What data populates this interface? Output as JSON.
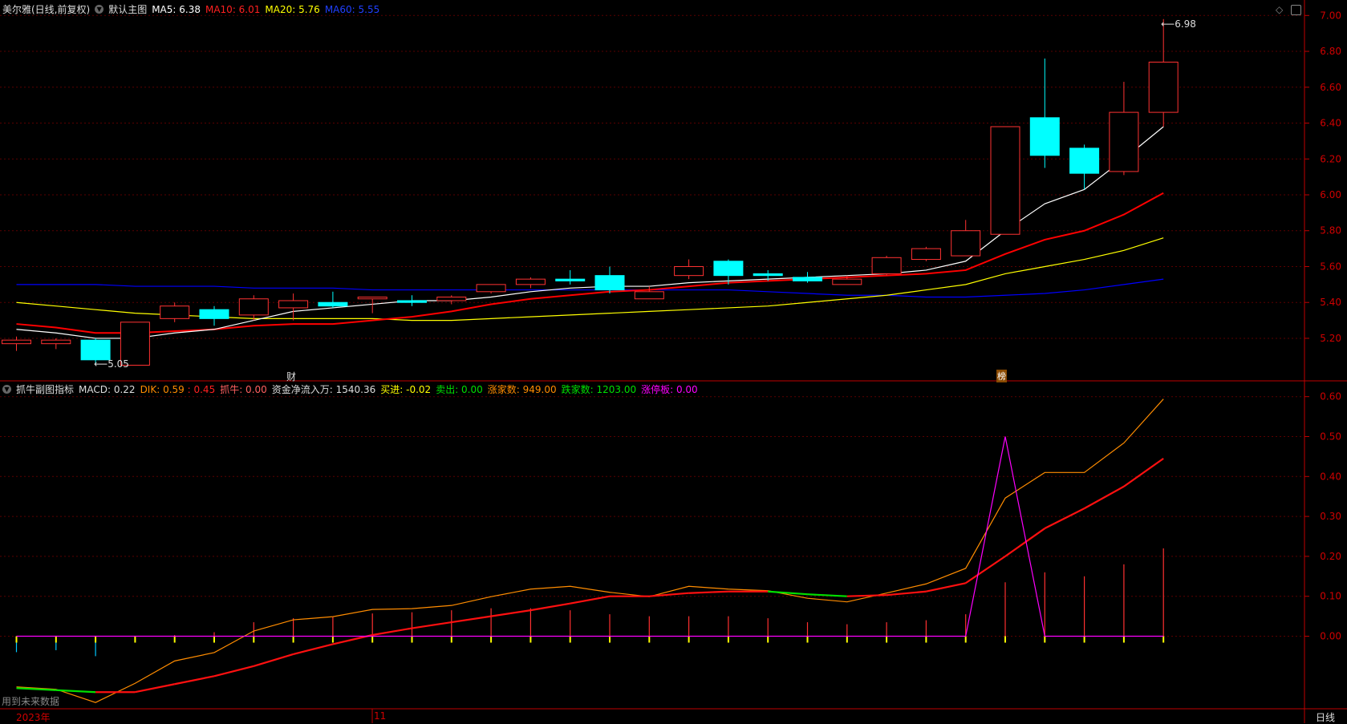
{
  "main_header": {
    "title": "美尔雅(日线,前复权)",
    "template": "默认主图",
    "ma5": "MA5: 6.38",
    "ma10": "MA10: 6.01",
    "ma20": "MA20: 5.76",
    "ma60": "MA60: 5.55"
  },
  "sub_header": {
    "title": "抓牛副图指标",
    "macd": "MACD: 0.22",
    "dik": "DIK: 0.59",
    "dik2": ": 0.45",
    "zhuaniu": "抓牛: 0.00",
    "fund_flow": "资金净流入万: 1540.36",
    "buy": "买进: -0.02",
    "sell": "卖出: 0.00",
    "up_count": "涨家数: 949.00",
    "down_count": "跌家数: 1203.00",
    "limit_up": "涨停板: 0.00"
  },
  "annotations": {
    "high_label": "6.98",
    "low_label": "5.05",
    "cai_marker": "财",
    "bang_marker": "榜",
    "future_data_note": "用到未来数据"
  },
  "bottom_axis": {
    "year": "2023年",
    "month": "11",
    "period": "日线"
  },
  "colors": {
    "up": "#ff3232",
    "down": "#00ffff",
    "ma5": "#ffffff",
    "ma10": "#ff0000",
    "ma20": "#ffff00",
    "ma60": "#0000ff",
    "axis": "#c00000"
  },
  "chart_data": [
    {
      "type": "candlestick",
      "title": "美尔雅 日线",
      "ylim": [
        5.05,
        7.05
      ],
      "yticks": [
        "7.00",
        "6.80",
        "6.60",
        "6.40",
        "6.20",
        "6.00",
        "5.80",
        "5.60",
        "5.40",
        "5.20"
      ],
      "ohlc": [
        [
          5.17,
          5.21,
          5.13,
          5.19
        ],
        [
          5.17,
          5.2,
          5.14,
          5.19
        ],
        [
          5.19,
          5.2,
          5.05,
          5.08
        ],
        [
          5.05,
          5.29,
          5.05,
          5.29
        ],
        [
          5.31,
          5.4,
          5.29,
          5.38
        ],
        [
          5.36,
          5.38,
          5.27,
          5.31
        ],
        [
          5.33,
          5.44,
          5.3,
          5.42
        ],
        [
          5.37,
          5.45,
          5.3,
          5.41
        ],
        [
          5.4,
          5.46,
          5.37,
          5.38
        ],
        [
          5.42,
          5.43,
          5.34,
          5.43
        ],
        [
          5.41,
          5.44,
          5.38,
          5.4
        ],
        [
          5.41,
          5.44,
          5.39,
          5.43
        ],
        [
          5.46,
          5.5,
          5.45,
          5.5
        ],
        [
          5.5,
          5.54,
          5.48,
          5.53
        ],
        [
          5.53,
          5.58,
          5.5,
          5.52
        ],
        [
          5.55,
          5.6,
          5.45,
          5.47
        ],
        [
          5.42,
          5.49,
          5.42,
          5.46
        ],
        [
          5.55,
          5.64,
          5.53,
          5.6
        ],
        [
          5.63,
          5.64,
          5.5,
          5.55
        ],
        [
          5.56,
          5.58,
          5.52,
          5.55
        ],
        [
          5.54,
          5.57,
          5.51,
          5.52
        ],
        [
          5.5,
          5.55,
          5.5,
          5.53
        ],
        [
          5.56,
          5.66,
          5.55,
          5.65
        ],
        [
          5.64,
          5.71,
          5.63,
          5.7
        ],
        [
          5.66,
          5.86,
          5.66,
          5.8
        ],
        [
          5.78,
          6.38,
          5.78,
          6.38
        ],
        [
          6.43,
          6.76,
          6.15,
          6.22
        ],
        [
          6.26,
          6.28,
          6.03,
          6.12
        ],
        [
          6.13,
          6.63,
          6.11,
          6.46
        ],
        [
          6.46,
          6.98,
          6.38,
          6.74
        ]
      ],
      "ma5": [
        5.25,
        5.23,
        5.2,
        5.2,
        5.23,
        5.25,
        5.3,
        5.35,
        5.37,
        5.39,
        5.41,
        5.41,
        5.43,
        5.46,
        5.48,
        5.49,
        5.49,
        5.51,
        5.52,
        5.53,
        5.54,
        5.55,
        5.56,
        5.58,
        5.63,
        5.8,
        5.95,
        6.03,
        6.2,
        6.38
      ],
      "ma10": [
        5.28,
        5.26,
        5.23,
        5.23,
        5.24,
        5.25,
        5.27,
        5.28,
        5.28,
        5.3,
        5.32,
        5.35,
        5.39,
        5.42,
        5.44,
        5.46,
        5.47,
        5.49,
        5.51,
        5.52,
        5.53,
        5.54,
        5.55,
        5.56,
        5.58,
        5.67,
        5.75,
        5.8,
        5.89,
        6.01
      ],
      "ma20": [
        5.4,
        5.38,
        5.36,
        5.34,
        5.33,
        5.32,
        5.31,
        5.31,
        5.31,
        5.31,
        5.3,
        5.3,
        5.31,
        5.32,
        5.33,
        5.34,
        5.35,
        5.36,
        5.37,
        5.38,
        5.4,
        5.42,
        5.44,
        5.47,
        5.5,
        5.56,
        5.6,
        5.64,
        5.69,
        5.76
      ],
      "ma60": [
        5.5,
        5.5,
        5.5,
        5.49,
        5.49,
        5.49,
        5.48,
        5.48,
        5.48,
        5.47,
        5.47,
        5.47,
        5.47,
        5.47,
        5.47,
        5.47,
        5.47,
        5.47,
        5.47,
        5.46,
        5.45,
        5.44,
        5.44,
        5.43,
        5.43,
        5.44,
        5.45,
        5.47,
        5.5,
        5.53
      ]
    },
    {
      "type": "line",
      "title": "抓牛副图指标",
      "ylim": [
        -0.19,
        0.64
      ],
      "yticks": [
        "0.60",
        "0.50",
        "0.40",
        "0.30",
        "0.20",
        "0.10",
        "0.00"
      ],
      "dik": [
        -0.127,
        -0.133,
        -0.166,
        -0.118,
        -0.062,
        -0.041,
        0.013,
        0.041,
        0.049,
        0.067,
        0.069,
        0.077,
        0.099,
        0.118,
        0.125,
        0.11,
        0.099,
        0.125,
        0.118,
        0.114,
        0.095,
        0.086,
        0.108,
        0.131,
        0.17,
        0.346,
        0.41,
        0.41,
        0.484,
        0.594
      ],
      "dik2": [
        -0.13,
        -0.135,
        -0.14,
        -0.14,
        -0.12,
        -0.1,
        -0.075,
        -0.045,
        -0.02,
        0.003,
        0.02,
        0.035,
        0.05,
        0.065,
        0.082,
        0.1,
        0.1,
        0.108,
        0.112,
        0.112,
        0.105,
        0.1,
        0.103,
        0.112,
        0.133,
        0.2,
        0.27,
        0.32,
        0.375,
        0.445
      ],
      "dik2_down_segments": [
        0,
        1,
        19,
        20
      ],
      "limit_up": [
        0,
        0,
        0,
        0,
        0,
        0,
        0,
        0,
        0,
        0,
        0,
        0,
        0,
        0,
        0,
        0,
        0,
        0,
        0,
        0,
        0,
        0,
        0,
        0,
        0,
        0.5,
        0,
        0,
        0,
        0
      ],
      "macd_bars": [
        -0.04,
        -0.035,
        -0.05,
        0,
        0.003,
        0.01,
        0.035,
        0.045,
        0.048,
        0.057,
        0.06,
        0.065,
        0.07,
        0.07,
        0.065,
        0.055,
        0.05,
        0.05,
        0.05,
        0.045,
        0.035,
        0.03,
        0.035,
        0.04,
        0.055,
        0.135,
        0.16,
        0.15,
        0.18,
        0.22
      ]
    }
  ]
}
